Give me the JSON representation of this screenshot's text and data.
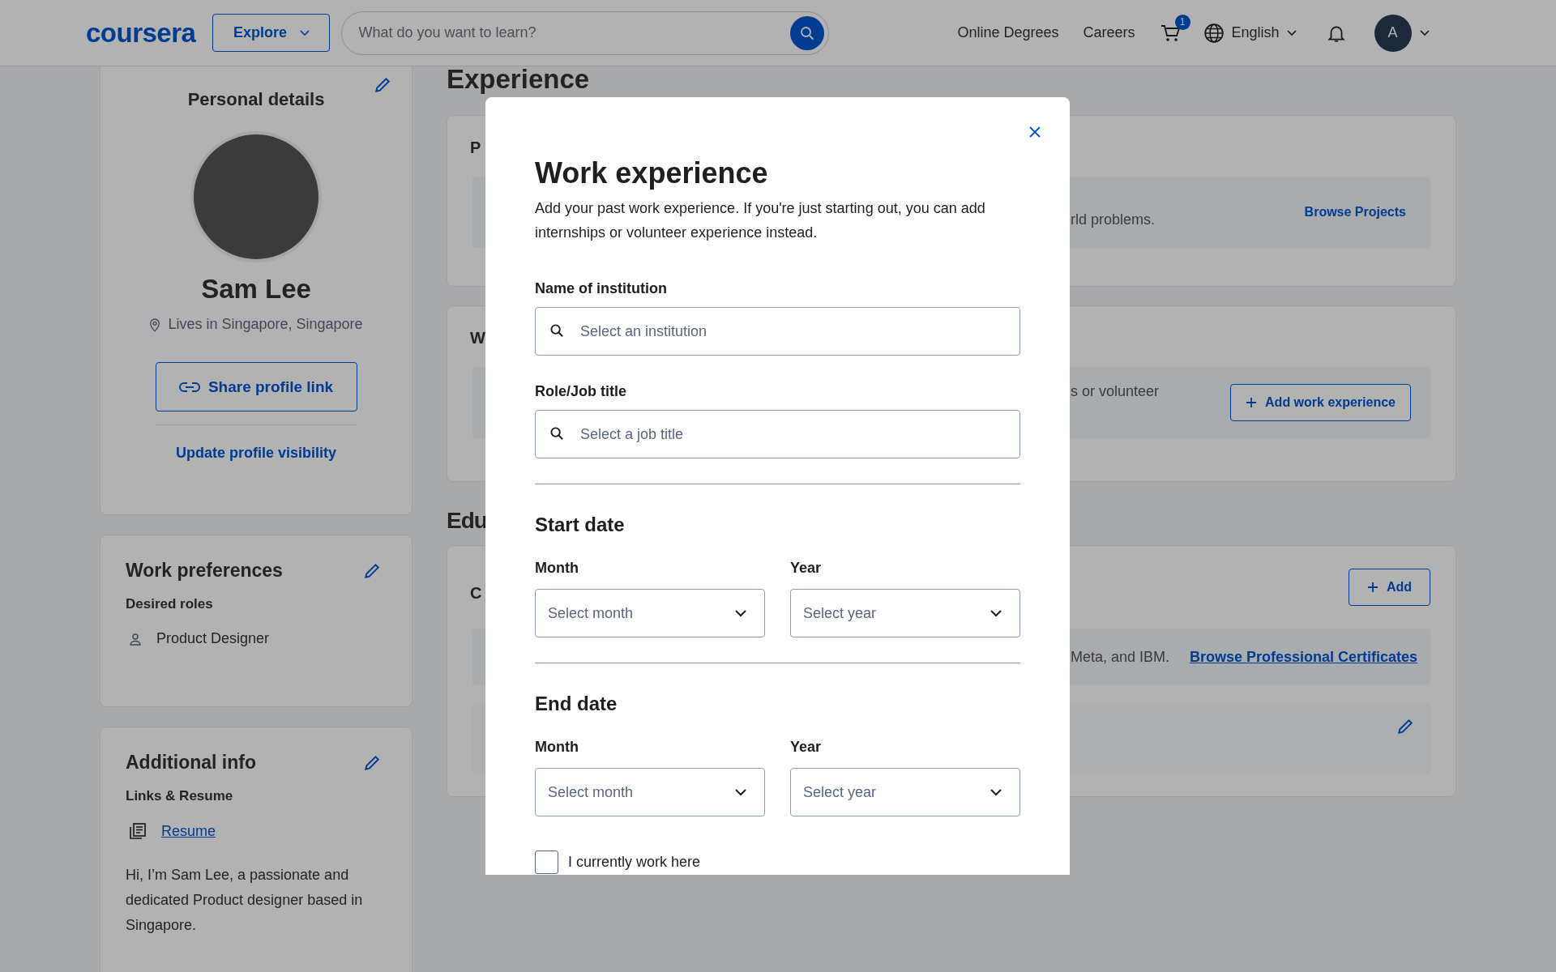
{
  "header": {
    "logo": "coursera",
    "explore": "Explore",
    "search_placeholder": "What do you want to learn?",
    "links": [
      "Online Degrees",
      "Careers"
    ],
    "cart_count": "1",
    "language": "English",
    "avatar_initial": "A"
  },
  "personal_details": {
    "title": "Personal details",
    "name": "Sam Lee",
    "location": "Lives in Singapore, Singapore",
    "share_button": "Share profile link",
    "visibility_link": "Update profile visibility"
  },
  "work_preferences": {
    "title": "Work preferences",
    "subtitle": "Desired roles",
    "roles": [
      "Product Designer"
    ]
  },
  "additional_info": {
    "title": "Additional info",
    "subtitle": "Links & Resume",
    "resume_link": "Resume",
    "bio": "Hi, I’m Sam Lee, a passionate and dedicated Product designer based in Singapore."
  },
  "experience": {
    "heading": "Experience",
    "cards": [
      {
        "title_fragment": "P",
        "text_fragment": "rld problems.",
        "action": {
          "kind": "text-link",
          "label": "Browse Projects"
        }
      },
      {
        "title_fragment": "W",
        "text_fragment": "s or volunteer",
        "action": {
          "kind": "outline-button",
          "label": "Add work experience"
        }
      }
    ]
  },
  "education": {
    "heading_fragment": "Edu",
    "card": {
      "title_fragment": "C",
      "add_button": "Add",
      "text_fragment": "Meta, and IBM.",
      "link": "Browse Professional Certificates"
    }
  },
  "modal": {
    "title": "Work experience",
    "description": "Add your past work experience. If you're just starting out, you can add internships or volunteer experience instead.",
    "fields": [
      {
        "label": "Name of institution",
        "placeholder": "Select an institution"
      },
      {
        "label": "Role/Job title",
        "placeholder": "Select a job title"
      }
    ],
    "date_groups": [
      {
        "title": "Start date",
        "selects": [
          {
            "label": "Month",
            "placeholder": "Select month"
          },
          {
            "label": "Year",
            "placeholder": "Select year"
          }
        ]
      },
      {
        "title": "End date",
        "selects": [
          {
            "label": "Month",
            "placeholder": "Select month"
          },
          {
            "label": "Year",
            "placeholder": "Select year"
          }
        ]
      }
    ],
    "checkbox": {
      "label": "I currently work here",
      "checked": false
    }
  }
}
